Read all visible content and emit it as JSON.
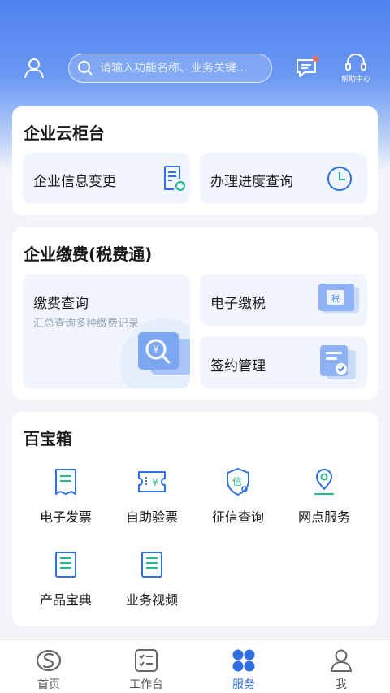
{
  "header": {
    "search_placeholder": "请输入功能名称、业务关键...",
    "help_label": "帮助中心"
  },
  "cloud_counter": {
    "title": "企业云柜台",
    "tiles": [
      {
        "label": "企业信息变更",
        "icon": "document-refresh-icon"
      },
      {
        "label": "办理进度查询",
        "icon": "clock-icon"
      }
    ]
  },
  "payment": {
    "title": "企业缴费(税费通)",
    "query": {
      "label": "缴费查询",
      "subtitle": "汇总查询多种缴费记录"
    },
    "tax": {
      "label": "电子缴税",
      "badge": "税"
    },
    "contract": {
      "label": "签约管理"
    }
  },
  "toolbox": {
    "title": "百宝箱",
    "items": [
      {
        "label": "电子发票",
        "icon": "invoice-icon"
      },
      {
        "label": "自助验票",
        "icon": "ticket-yen-icon",
        "glyph": "¥"
      },
      {
        "label": "征信查询",
        "icon": "credit-shield-icon",
        "glyph": "信"
      },
      {
        "label": "网点服务",
        "icon": "location-pin-icon"
      },
      {
        "label": "产品宝典",
        "icon": "product-book-icon"
      },
      {
        "label": "业务视频",
        "icon": "video-doc-icon"
      }
    ]
  },
  "tabbar": {
    "tabs": [
      {
        "label": "首页",
        "icon": "bank-logo-icon",
        "active": false
      },
      {
        "label": "工作台",
        "icon": "checklist-icon",
        "active": false
      },
      {
        "label": "服务",
        "icon": "grid-dots-icon",
        "active": true
      },
      {
        "label": "我",
        "icon": "person-icon",
        "active": false
      }
    ]
  },
  "colors": {
    "accent": "#2f6fe0",
    "header_gradient_top": "#4f82f0",
    "tile_bg": "#f1f6fe",
    "notification_dot": "#ff6b4a"
  }
}
